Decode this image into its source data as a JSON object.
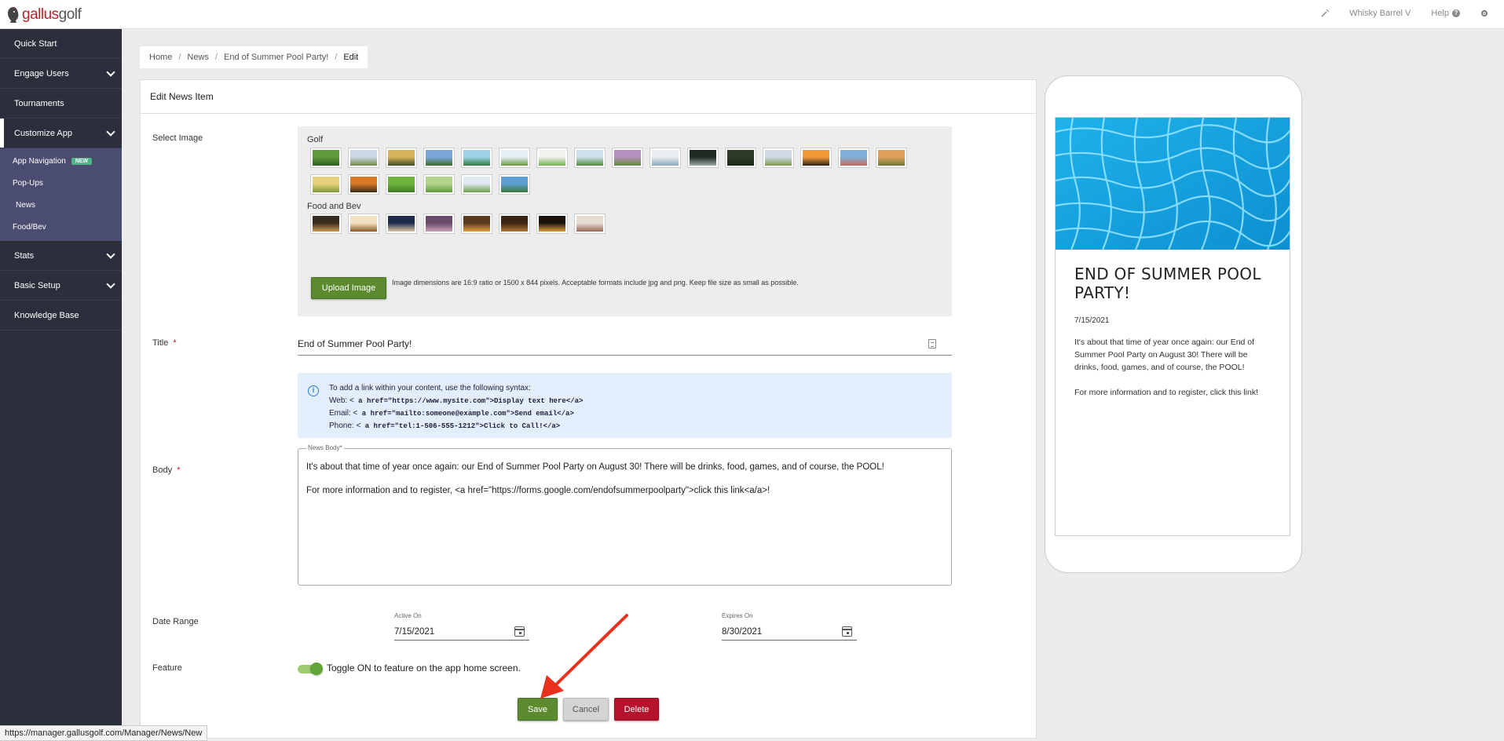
{
  "brand": {
    "logo_part1": "gallus",
    "logo_part2": "golf"
  },
  "topbar": {
    "user": "Whisky Barrel V",
    "help": "Help"
  },
  "sidebar": {
    "items": [
      {
        "label": "Quick Start"
      },
      {
        "label": "Engage Users"
      },
      {
        "label": "Tournaments"
      },
      {
        "label": "Customize App"
      }
    ],
    "subitems": [
      {
        "label": "App Navigation",
        "badge": "NEW"
      },
      {
        "label": "Pop-Ups"
      },
      {
        "label": "News"
      },
      {
        "label": "Food/Bev"
      }
    ],
    "items_after": [
      {
        "label": "Stats"
      },
      {
        "label": "Basic Setup"
      },
      {
        "label": "Knowledge Base"
      }
    ]
  },
  "breadcrumb": [
    "Home",
    "News",
    "End of Summer Pool Party!",
    "Edit"
  ],
  "form": {
    "header": "Edit News Item",
    "select_image_label": "Select Image",
    "image_categories": [
      {
        "name": "Golf",
        "count": 22
      },
      {
        "name": "Food and Bev",
        "count": 8
      }
    ],
    "upload_label": "Upload Image",
    "upload_hint": "Image dimensions are 16:9 ratio or 1500 x 844 pixels. Acceptable formats include jpg and png. Keep file size as small as possible.",
    "title_label": "Title",
    "required_mark": "*",
    "title_value": "End of Summer Pool Party!",
    "info": {
      "intro": "To add a link within your content, use the following syntax:",
      "web_label": "Web: <",
      "web_code": " a href=\"https://www.mysite.com\">Display text here</a>",
      "email_label": "Email: <",
      "email_code": " a href=\"mailto:someone@example.com\">Send email</a>",
      "phone_label": "Phone: <",
      "phone_code": " a href=\"tel:1-506-555-1212\">Click to Call!</a>"
    },
    "body_label": "Body",
    "body_legend": "News Body*",
    "body_p1": "It's about that time of year once again: our End of Summer Pool Party on August 30! There will be drinks, food, games, and of course, the POOL!",
    "body_p2": "For more information and to register, <a href=\"https://forms.google.com/endofsummerpoolparty\">click this link<a/a>!",
    "date_range_label": "Date Range",
    "active_on_label": "Active On",
    "active_on_value": "7/15/2021",
    "expires_on_label": "Expires On",
    "expires_on_value": "8/30/2021",
    "feature_label": "Feature",
    "feature_toggle_text": "Toggle ON to feature on the app home screen.",
    "feature_on": true,
    "save_label": "Save",
    "cancel_label": "Cancel",
    "delete_label": "Delete"
  },
  "preview": {
    "title": "END OF SUMMER POOL PARTY!",
    "date": "7/15/2021",
    "p1": "It's about that time of year once again: our End of Summer Pool Party on August 30! There will be drinks, food, games, and of course, the POOL!",
    "p2": "For more information and to register, click this link!"
  },
  "statusbar": {
    "url": "https://manager.gallusgolf.com/Manager/News/New"
  },
  "colors": {
    "sidebar_bg": "#2b2f3b",
    "submenu_bg": "#4b4d70",
    "save_green": "#5c8a2e",
    "delete_red": "#b6122c",
    "info_bg": "#e3eefc",
    "annotation_arrow": "#e8301c"
  }
}
